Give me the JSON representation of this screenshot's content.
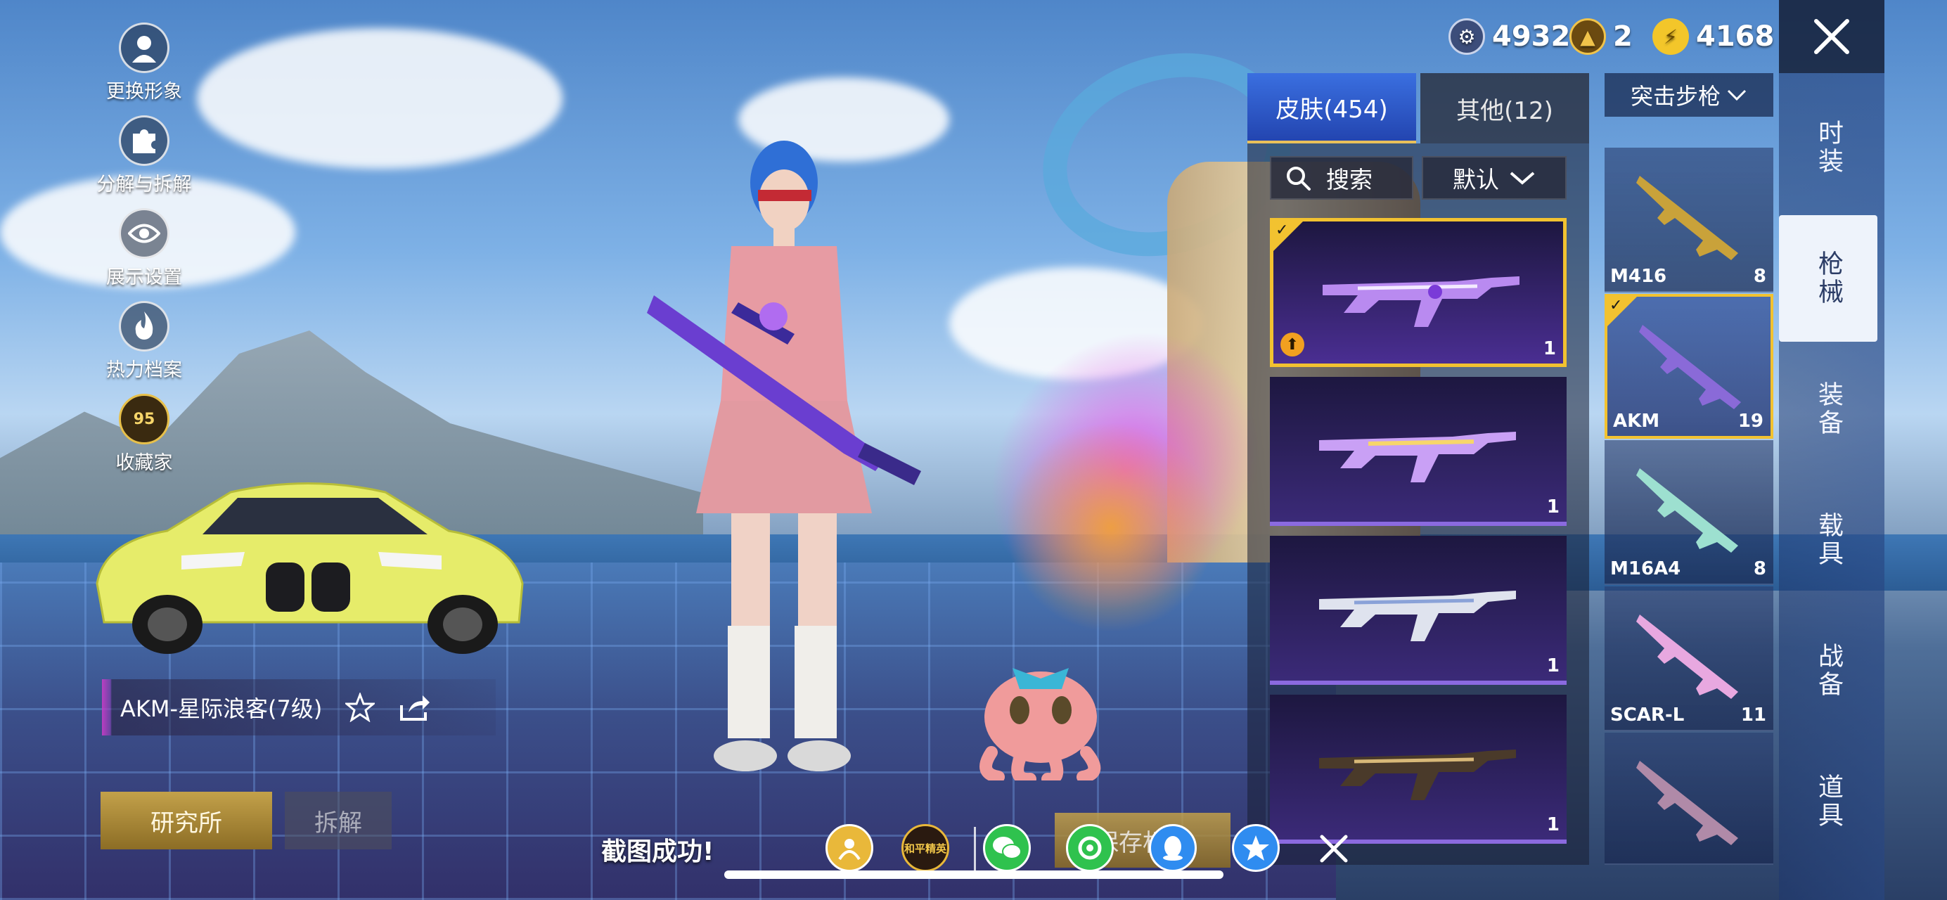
{
  "currency": [
    {
      "icon": "silver-coin-icon",
      "value": "4932"
    },
    {
      "icon": "gold-triangle-icon",
      "value": "2"
    },
    {
      "icon": "lightning-coin-icon",
      "value": "4168"
    }
  ],
  "left_menu": [
    {
      "label": "更换形象",
      "icon": "avatar-icon"
    },
    {
      "label": "分解与拆解",
      "icon": "puzzle-icon"
    },
    {
      "label": "展示设置",
      "icon": "eye-icon"
    },
    {
      "label": "热力档案",
      "icon": "flame-icon"
    },
    {
      "label": "收藏家",
      "icon": "collector-badge-icon",
      "badge": "95"
    }
  ],
  "skin_name": "AKM-星际浪客(7级)",
  "buttons": {
    "lab": "研究所",
    "dismantle": "拆解",
    "save": "保存相册"
  },
  "tabs": {
    "skins": "皮肤(454)",
    "other": "其他(12)"
  },
  "search": {
    "label": "搜索"
  },
  "sort": {
    "label": "默认"
  },
  "skins": [
    {
      "count": "1",
      "selected": true,
      "upgradable": true
    },
    {
      "count": "1",
      "selected": false
    },
    {
      "count": "1",
      "selected": false
    },
    {
      "count": "1",
      "selected": false
    }
  ],
  "category": "突击步枪",
  "weapons": [
    {
      "name": "M416",
      "count": "8"
    },
    {
      "name": "AKM",
      "count": "19",
      "selected": true
    },
    {
      "name": "M16A4",
      "count": "8"
    },
    {
      "name": "SCAR-L",
      "count": "11"
    },
    {
      "name": "",
      "count": ""
    }
  ],
  "nav": [
    {
      "label": "时装"
    },
    {
      "label": "枪械",
      "active": true
    },
    {
      "label": "装备"
    },
    {
      "label": "载具"
    },
    {
      "label": "战备"
    },
    {
      "label": "道具"
    }
  ],
  "toast": "截图成功!",
  "share_icons": [
    "profile-share-icon",
    "game-logo-icon",
    "wechat-icon",
    "moments-icon",
    "qq-icon",
    "qzone-icon"
  ],
  "game_logo_text": "和平精英",
  "colors": {
    "accent_gold": "#f2c230",
    "tab_blue": "#2f5fd0",
    "skin_purple": "#3b2a78"
  }
}
